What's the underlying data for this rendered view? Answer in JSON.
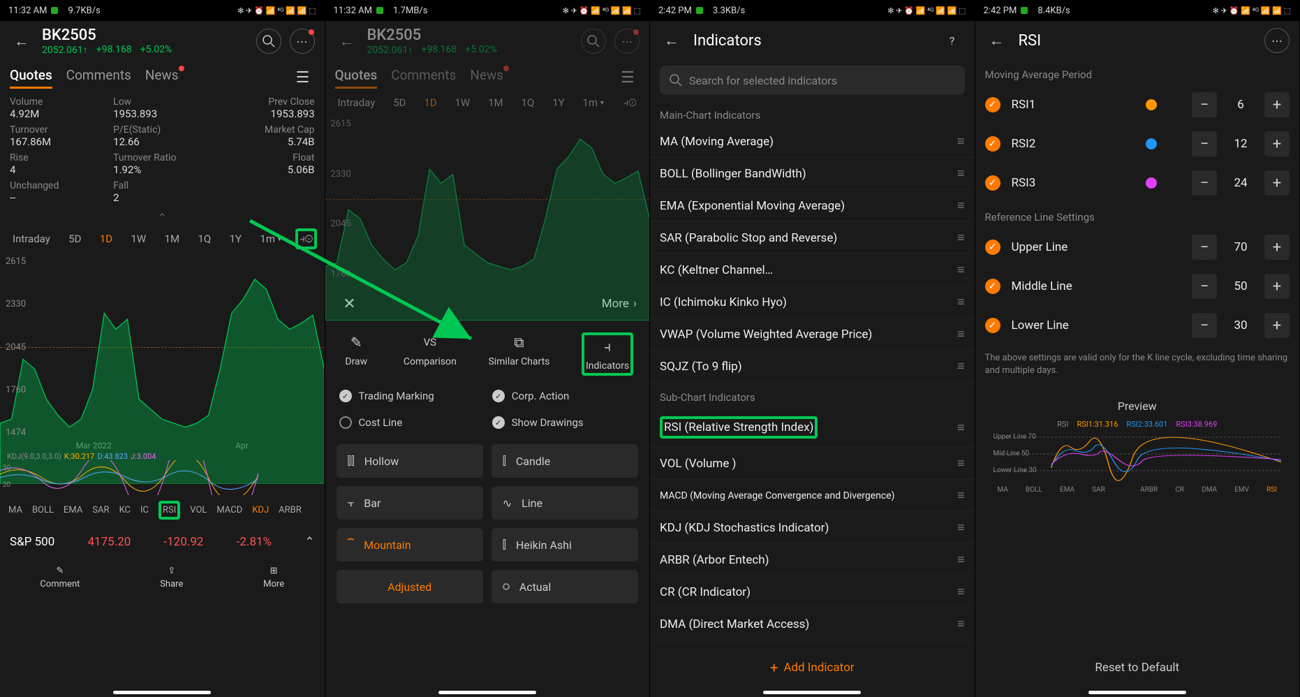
{
  "status": {
    "time1": "11:32 AM",
    "speed1": "9.7KB/s",
    "time2": "11:32 AM",
    "speed2": "1.7MB/s",
    "time3": "2:42 PM",
    "speed3": "3.3KB/s",
    "time4": "2:42 PM",
    "speed4": "8.4KB/s",
    "battery": "40",
    "icons": "✻ ✈ ⏰ 📶 ⁴ᴳ 📶 📶 ⬚"
  },
  "header": {
    "symbol": "BK2505",
    "price": "2052.061↑",
    "change": "+98.168",
    "pct": "+5.02%"
  },
  "tabs": {
    "quotes": "Quotes",
    "comments": "Comments",
    "news": "News"
  },
  "grid": {
    "volume_l": "Volume",
    "volume_v": "4.92M",
    "low_l": "Low",
    "low_v": "1953.893",
    "prev_l": "Prev Close",
    "prev_v": "1953.893",
    "turn_l": "Turnover",
    "turn_v": "167.86M",
    "pe_l": "P/E(Static)",
    "pe_v": "12.66",
    "mcap_l": "Market Cap",
    "mcap_v": "5.74B",
    "rise_l": "Rise",
    "rise_v": "4",
    "tr_l": "Turnover Ratio",
    "tr_v": "1.92%",
    "float_l": "Float",
    "float_v": "5.06B",
    "unch_l": "Unchanged",
    "unch_v": "--",
    "fall_l": "Fall",
    "fall_v": "2"
  },
  "tf": [
    "Intraday",
    "5D",
    "1D",
    "1W",
    "1M",
    "1Q",
    "1Y",
    "1m"
  ],
  "tf_active": 2,
  "chart_data": {
    "type": "area",
    "yticks": [
      2615,
      2330,
      2045,
      1760,
      1474
    ],
    "xlabels": [
      "Mar 2022",
      "Apr"
    ],
    "points": [
      1780,
      1800,
      2100,
      2050,
      1900,
      1820,
      1760,
      1800,
      1950,
      2330,
      2250,
      2300,
      1900,
      1850,
      1800,
      1780,
      1760,
      1780,
      1820,
      2050,
      2330,
      2400,
      2500,
      2450,
      2300,
      2250,
      2280,
      2320,
      2050
    ],
    "ref_line_y": 2045,
    "kdj": {
      "label": "KDJ(9.0,3.0,3.0)",
      "K": "K:30.217",
      "D": "D:43.823",
      "J": "J:3.004",
      "scale": [
        50,
        20
      ]
    }
  },
  "ind_strip": [
    "MA",
    "BOLL",
    "EMA",
    "SAR",
    "KC",
    "IC",
    "RSI",
    "VOL",
    "MACD",
    "KDJ",
    "ARBR"
  ],
  "ind_strip_active": 9,
  "sp500": {
    "name": "S&P 500",
    "price": "4175.20",
    "chg": "-120.92",
    "pct": "-2.81%"
  },
  "bottom": {
    "comment": "Comment",
    "share": "Share",
    "more": "More"
  },
  "sheet": {
    "more": "More",
    "draw": "Draw",
    "comparison": "Comparison",
    "similar": "Similar Charts",
    "indicators": "Indicators",
    "trading": "Trading Marking",
    "corp": "Corp. Action",
    "cost": "Cost Line",
    "show": "Show Drawings",
    "hollow": "Hollow",
    "candle": "Candle",
    "bar": "Bar",
    "line": "Line",
    "mountain": "Mountain",
    "heikin": "Heikin Ashi",
    "adjusted": "Adjusted",
    "actual": "Actual"
  },
  "screen3": {
    "title": "Indicators",
    "search": "Search for selected indicators",
    "main_lbl": "Main-Chart Indicators",
    "main": [
      "MA (Moving Average)",
      "BOLL (Bollinger BandWidth)",
      "EMA (Exponential Moving Average)",
      "SAR (Parabolic Stop and Reverse)",
      "KC (Keltner Channel…",
      "IC (Ichimoku Kinko Hyo)",
      "VWAP (Volume Weighted Average Price)",
      "SQJZ (To 9 flip)"
    ],
    "sub_lbl": "Sub-Chart Indicators",
    "sub": [
      "RSI (Relative Strength Index)",
      "VOL (Volume )",
      "MACD (Moving Average Convergence and Divergence)",
      "KDJ (KDJ Stochastics Indicator)",
      "ARBR (Arbor Entech)",
      "CR (CR Indicator)",
      "DMA (Direct Market Access)"
    ],
    "add": "Add Indicator"
  },
  "screen4": {
    "title": "RSI",
    "map_lbl": "Moving Average Period",
    "rsi": [
      {
        "name": "RSI1",
        "color": "#ff9800",
        "val": "6"
      },
      {
        "name": "RSI2",
        "color": "#2196f3",
        "val": "12"
      },
      {
        "name": "RSI3",
        "color": "#e040fb",
        "val": "24"
      }
    ],
    "ref_lbl": "Reference Line Settings",
    "refs": [
      {
        "name": "Upper Line",
        "val": "70"
      },
      {
        "name": "Middle Line",
        "val": "50"
      },
      {
        "name": "Lower Line",
        "val": "30"
      }
    ],
    "note": "The above settings are valid only for the K line cycle, excluding time sharing and multiple days.",
    "preview": "Preview",
    "legend": [
      {
        "name": "RSI",
        "color": "#888"
      },
      {
        "name": "RSI1:31.316",
        "color": "#ff9800"
      },
      {
        "name": "RSI2:33.601",
        "color": "#2196f3"
      },
      {
        "name": "RSI3:38.969",
        "color": "#e040fb"
      }
    ],
    "pv_ref": [
      {
        "n": "Upper Line",
        "v": "70"
      },
      {
        "n": "Mid Line",
        "v": "50"
      },
      {
        "n": "Lower Line",
        "v": "30"
      }
    ],
    "pv_inds": [
      "MA",
      "BOLL",
      "EMA",
      "SAR",
      "",
      "ARBR",
      "CR",
      "DMA",
      "EMV",
      "RSI"
    ],
    "reset": "Reset to Default"
  }
}
